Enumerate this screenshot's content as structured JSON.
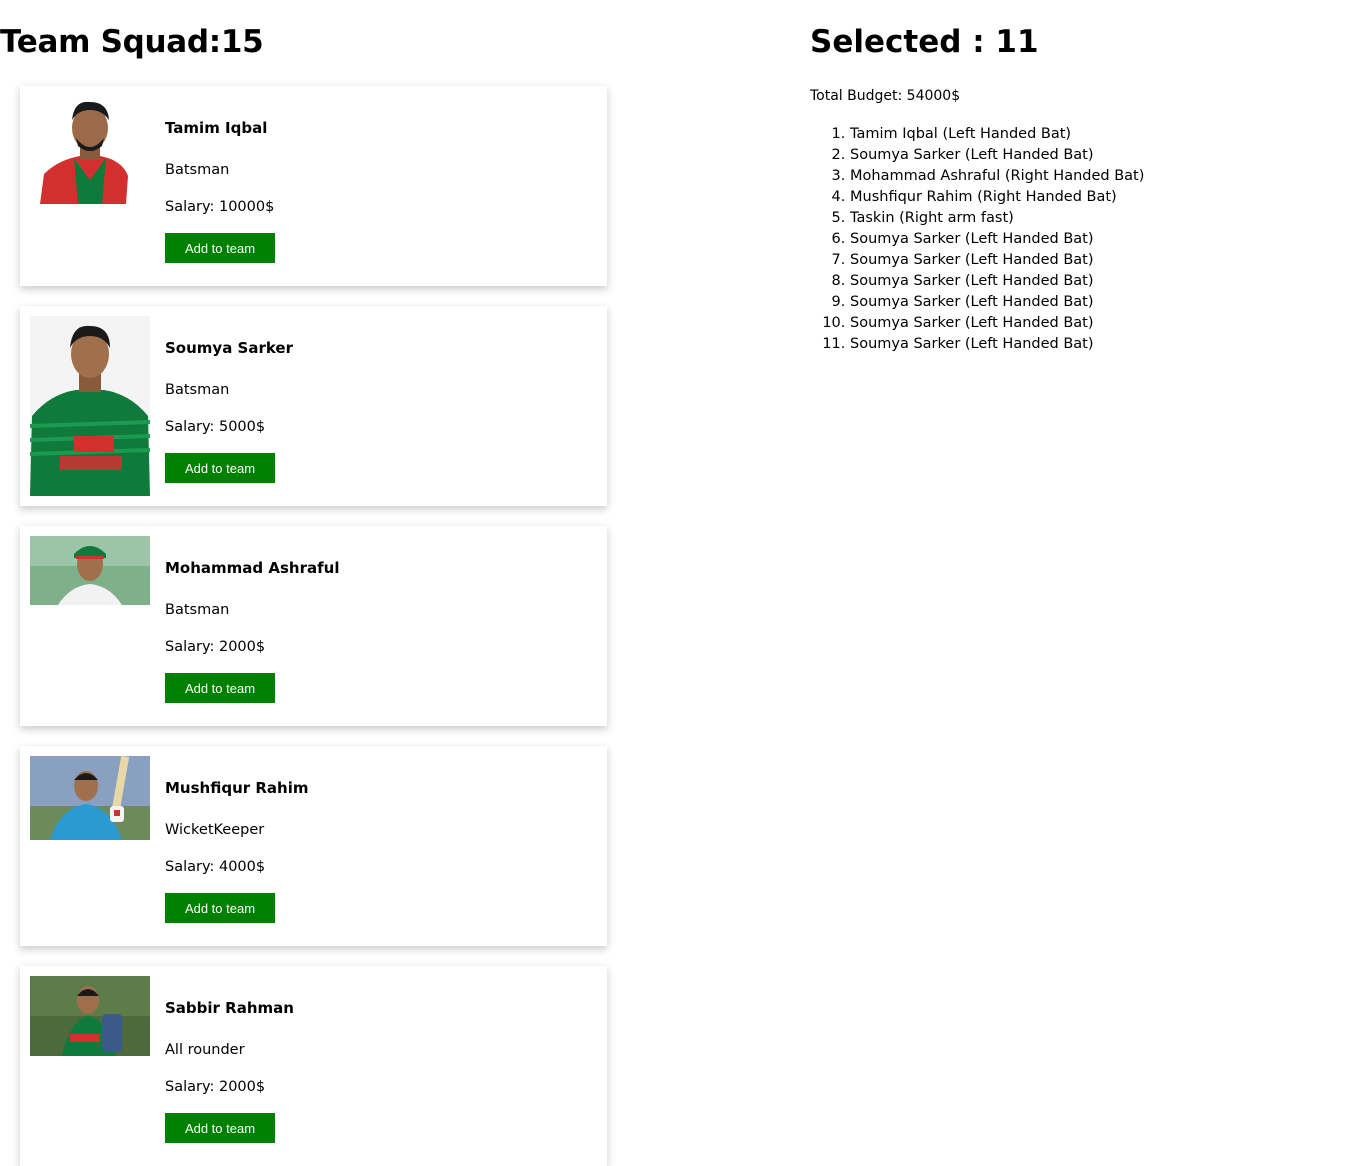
{
  "squad": {
    "heading": "Team Squad:15"
  },
  "summary": {
    "heading": "Selected : 11",
    "budget": "Total Budget: 54000$",
    "selected": [
      "Tamim Iqbal (Left Handed Bat)",
      "Soumya Sarker (Left Handed Bat)",
      "Mohammad Ashraful (Right Handed Bat)",
      "Mushfiqur Rahim (Right Handed Bat)",
      "Taskin (Right arm fast)",
      "Soumya Sarker (Left Handed Bat)",
      "Soumya Sarker (Left Handed Bat)",
      "Soumya Sarker (Left Handed Bat)",
      "Soumya Sarker (Left Handed Bat)",
      "Soumya Sarker (Left Handed Bat)",
      "Soumya Sarker (Left Handed Bat)"
    ]
  },
  "players": [
    {
      "name": "Tamim Iqbal",
      "role": "Batsman",
      "salary": "Salary: 10000$",
      "button": "Add to team"
    },
    {
      "name": "Soumya Sarker",
      "role": "Batsman",
      "salary": "Salary: 5000$",
      "button": "Add to team"
    },
    {
      "name": "Mohammad Ashraful",
      "role": "Batsman",
      "salary": "Salary: 2000$",
      "button": "Add to team"
    },
    {
      "name": "Mushfiqur Rahim",
      "role": "WicketKeeper",
      "salary": "Salary: 4000$",
      "button": "Add to team"
    },
    {
      "name": "Sabbir Rahman",
      "role": "All rounder",
      "salary": "Salary: 2000$",
      "button": "Add to team"
    }
  ],
  "colors": {
    "button": "#008000",
    "jersey_green": "#0f7a3c",
    "jersey_red": "#d32f2f"
  }
}
